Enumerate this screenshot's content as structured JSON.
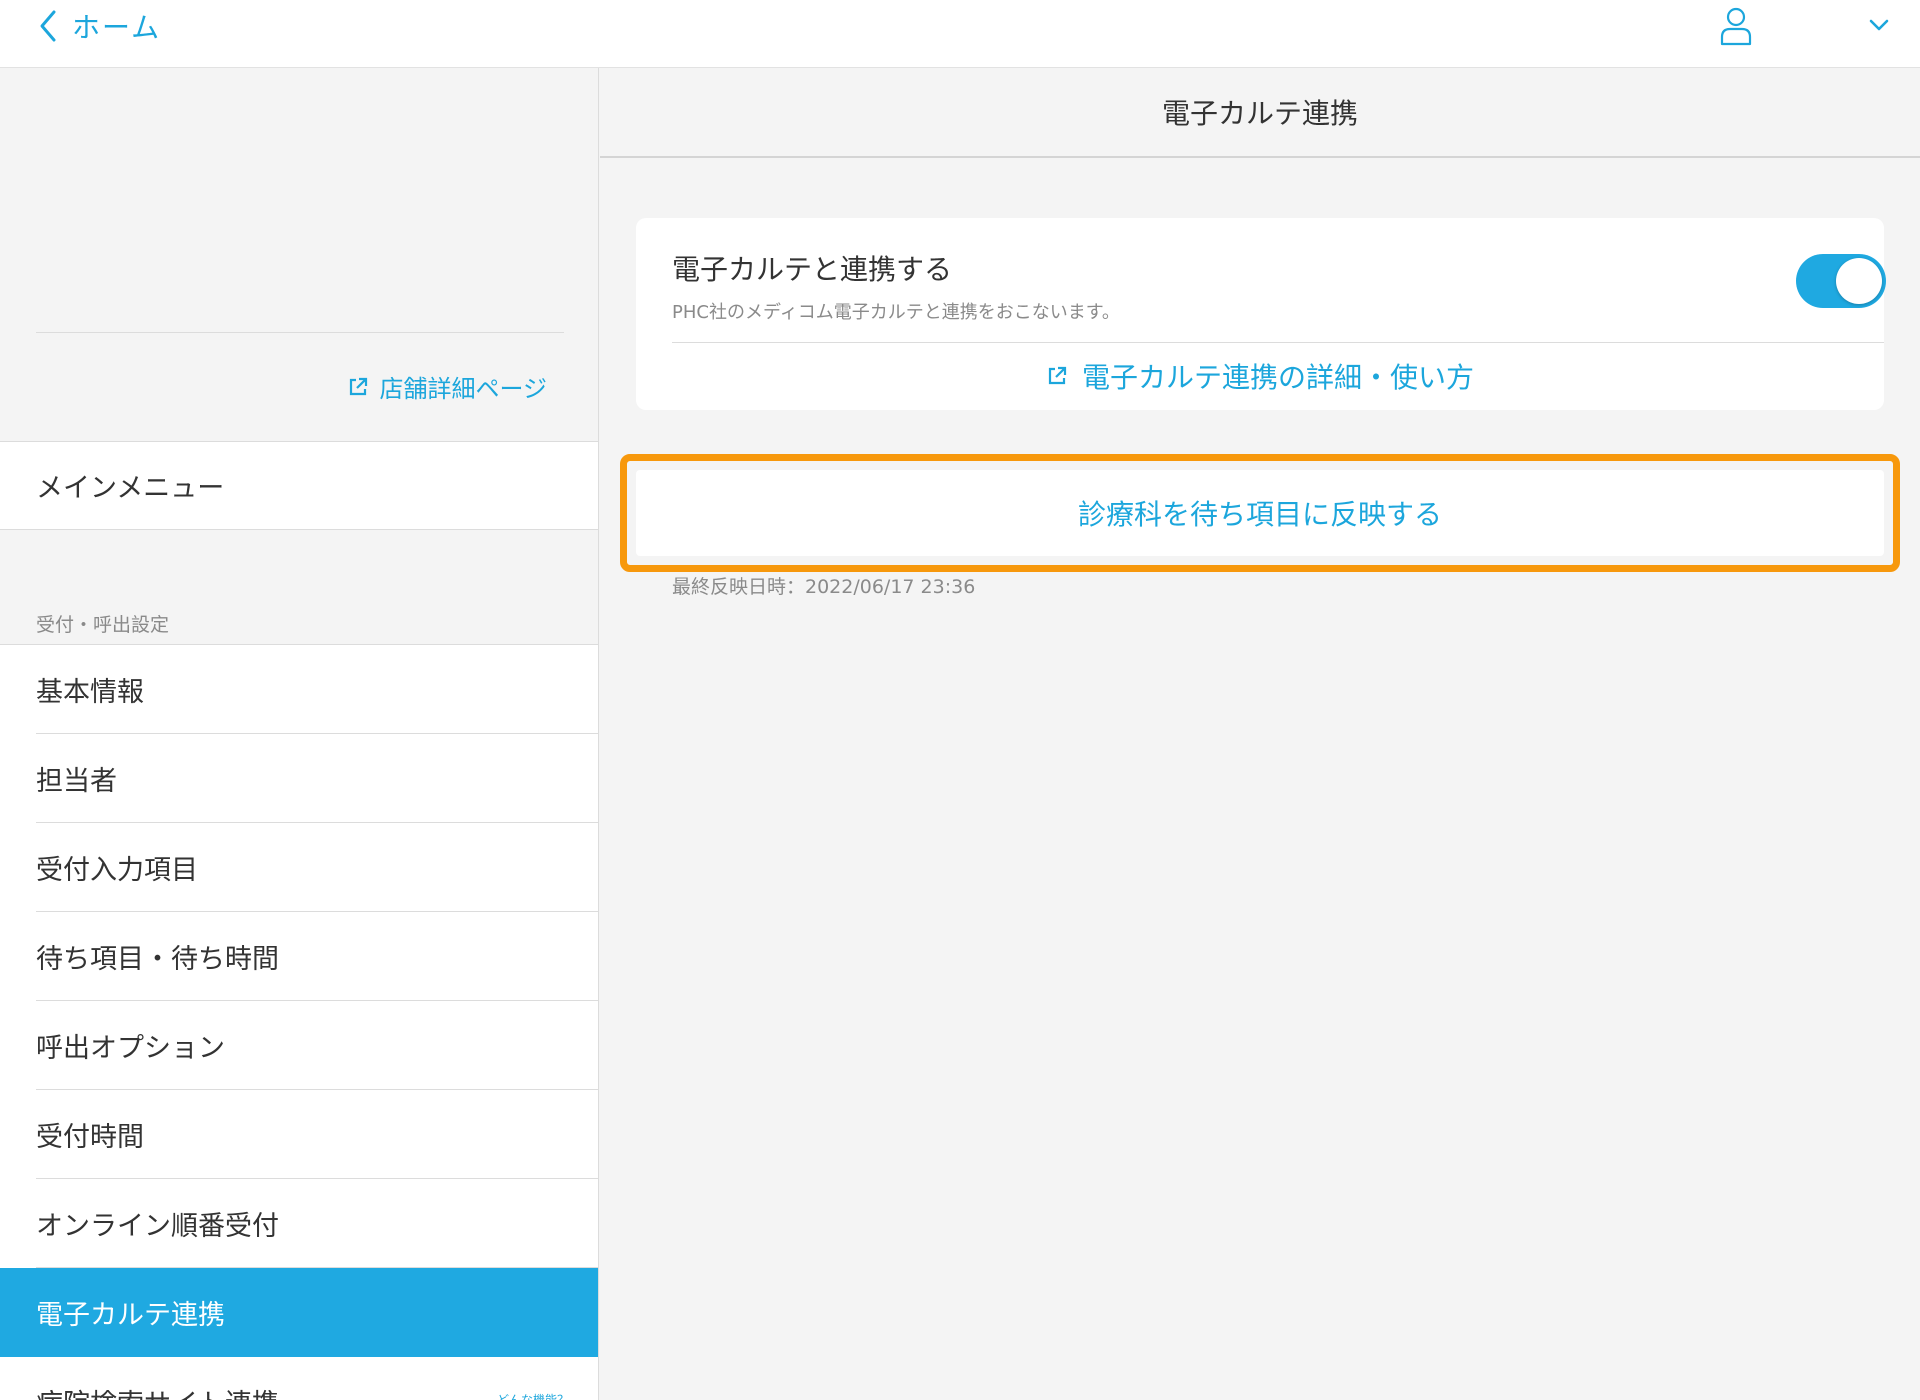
{
  "header": {
    "back_label": "ホーム",
    "icons": [
      "chevron-left-icon",
      "user-icon",
      "chevron-down-icon"
    ]
  },
  "sidebar": {
    "store_link": "店舗詳細ページ",
    "main_menu": "メインメニュー",
    "section_label": "受付・呼出設定",
    "items": [
      {
        "label": "基本情報"
      },
      {
        "label": "担当者"
      },
      {
        "label": "受付入力項目"
      },
      {
        "label": "待ち項目・待ち時間"
      },
      {
        "label": "呼出オプション"
      },
      {
        "label": "受付時間"
      },
      {
        "label": "オンライン順番受付"
      },
      {
        "label": "電子カルテ連携",
        "active": true
      },
      {
        "label": "病院検索サイト連携",
        "hint": "どんな機能？"
      }
    ]
  },
  "main": {
    "title": "電子カルテ連携",
    "card": {
      "title": "電子カルテと連携する",
      "description": "PHC社のメディコム電子カルテと連携をおこないます。",
      "toggle_on": true,
      "detail_link": "電子カルテ連携の詳細・使い方"
    },
    "reflect_button": "診療科を待ち項目に反映する",
    "last_reflect": "最終反映日時：2022/06/17 23:36"
  },
  "colors": {
    "accent": "#1fa9e1",
    "highlight": "#f7980c",
    "background": "#f4f4f4"
  }
}
